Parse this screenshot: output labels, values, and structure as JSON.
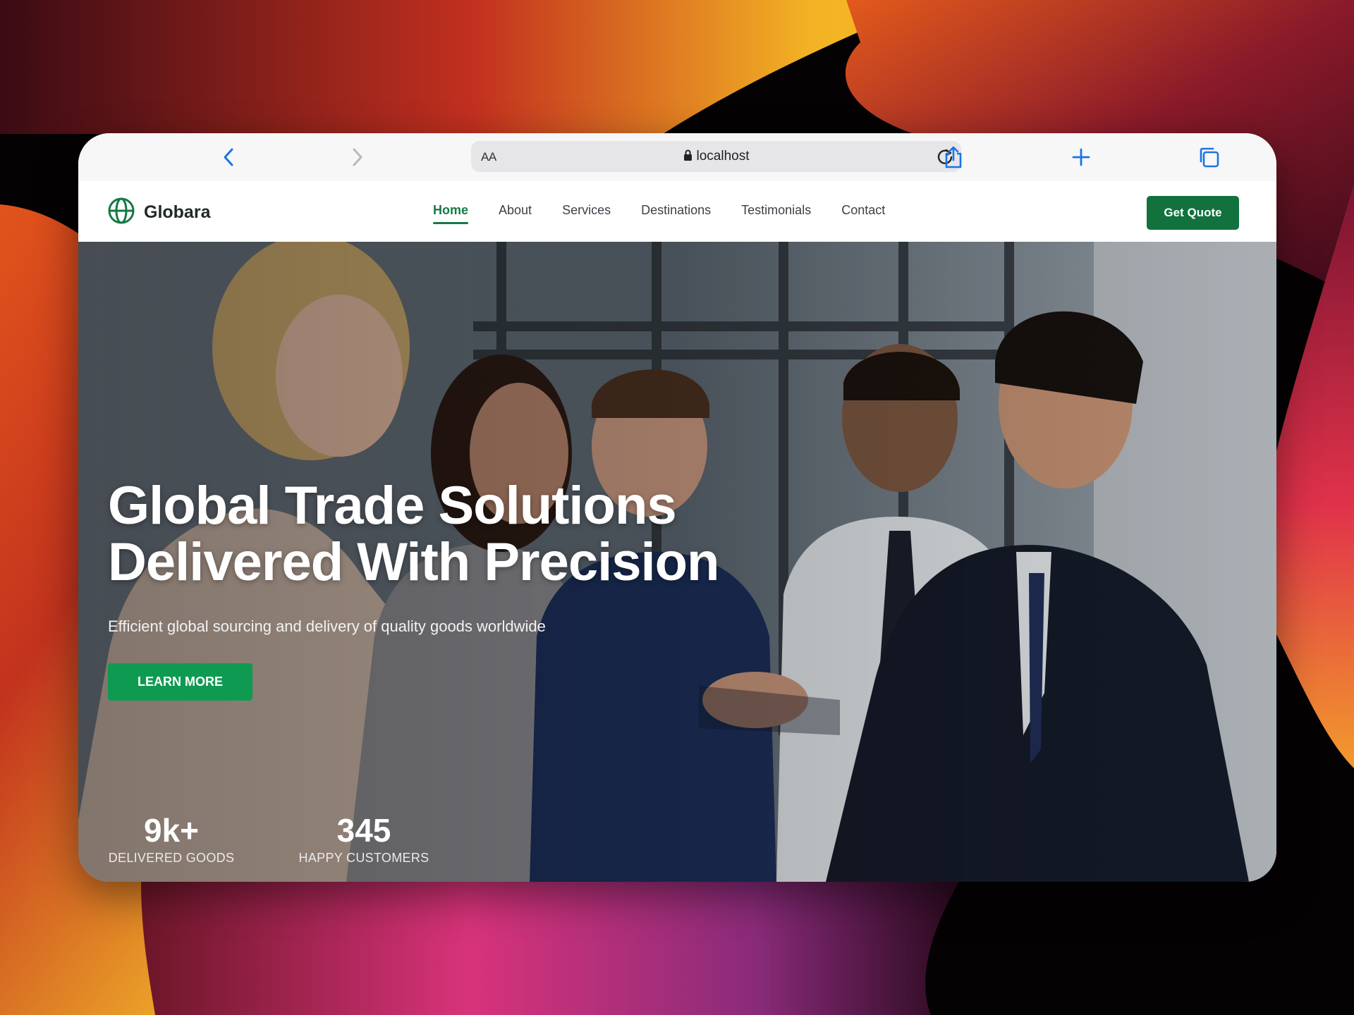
{
  "colors": {
    "brand_green": "#11723d",
    "cta_green": "#0f9a52",
    "safari_blue": "#1a73e8"
  },
  "browser": {
    "text_size_label": "AA",
    "url": "localhost",
    "icons": [
      "back-icon",
      "forward-icon",
      "bookmarks-icon",
      "lock-icon",
      "reload-icon",
      "share-icon",
      "new-tab-icon",
      "tabs-icon"
    ]
  },
  "site": {
    "brand": "Globara",
    "nav": [
      {
        "label": "Home",
        "active": true
      },
      {
        "label": "About",
        "active": false
      },
      {
        "label": "Services",
        "active": false
      },
      {
        "label": "Destinations",
        "active": false
      },
      {
        "label": "Testimonials",
        "active": false
      },
      {
        "label": "Contact",
        "active": false
      }
    ],
    "cta_label": "Get Quote"
  },
  "hero": {
    "title_line1": "Global Trade Solutions",
    "title_line2": "Delivered With Precision",
    "subtitle": "Efficient global sourcing and delivery of quality goods worldwide",
    "button_label": "LEARN MORE",
    "stats": [
      {
        "value": "9k+",
        "label": "DELIVERED GOODS"
      },
      {
        "value": "345",
        "label": "HAPPY CUSTOMERS"
      }
    ]
  }
}
